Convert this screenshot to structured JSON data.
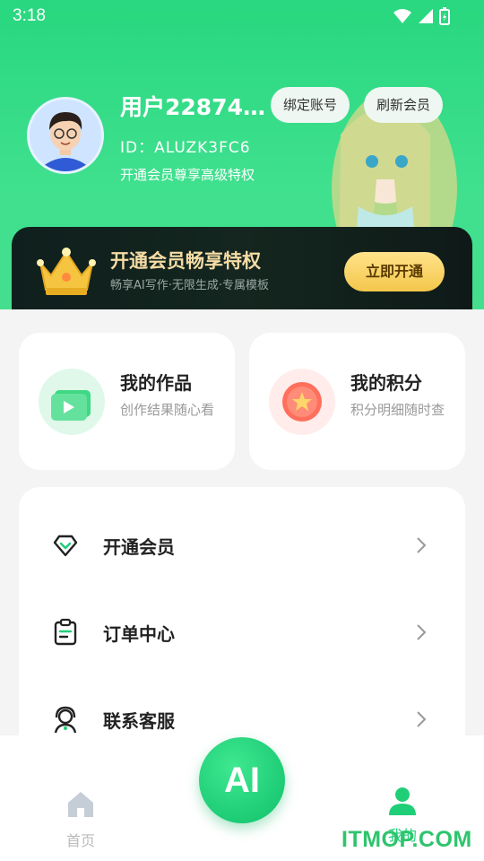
{
  "status_bar": {
    "time": "3:18"
  },
  "profile": {
    "username": "用户228742...",
    "user_id": "ID：ALUZK3FC6",
    "vip_hint": "开通会员尊享高级特权",
    "bind_button": "绑定账号",
    "refresh_button": "刷新会员"
  },
  "vip_banner": {
    "title": "开通会员畅享特权",
    "subtitle": "畅享AI写作·无限生成·专属模板",
    "button": "立即开通"
  },
  "cards": {
    "works": {
      "title": "我的作品",
      "desc": "创作结果随心看"
    },
    "points": {
      "title": "我的积分",
      "desc": "积分明细随时查"
    }
  },
  "menu": [
    {
      "label": "开通会员",
      "icon": "diamond-icon"
    },
    {
      "label": "订单中心",
      "icon": "clipboard-icon"
    },
    {
      "label": "联系客服",
      "icon": "headset-icon"
    }
  ],
  "tabbar": {
    "home_label": "首页",
    "ai_label": "AI",
    "mine_label": "我的"
  },
  "watermark": "ITMOP.COM",
  "colors": {
    "accent": "#28d77f",
    "vip_gold": "#f4c74c",
    "banner_dark": "#0f1f1d"
  }
}
